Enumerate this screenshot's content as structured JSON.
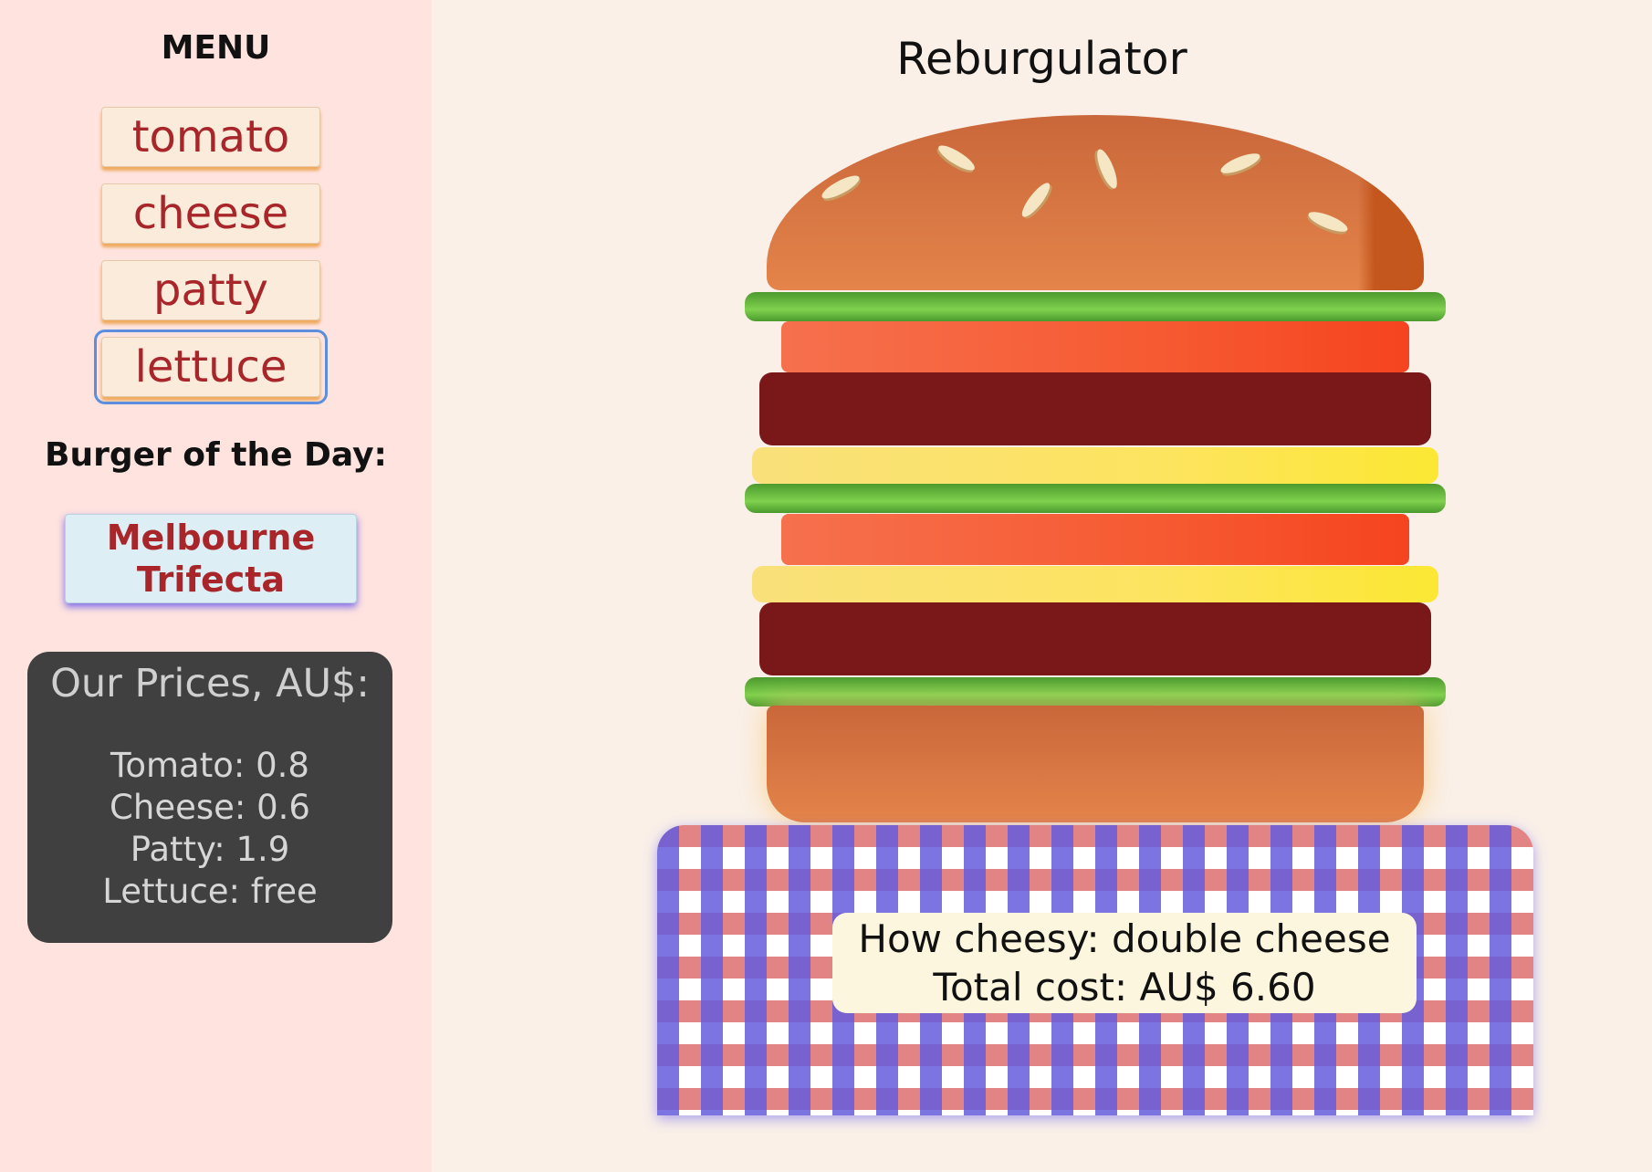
{
  "sidebar": {
    "menu_heading": "MENU",
    "menu_items": [
      {
        "label": "tomato"
      },
      {
        "label": "cheese"
      },
      {
        "label": "patty"
      },
      {
        "label": "lettuce"
      }
    ],
    "botd_heading": "Burger of the Day:",
    "botd_button": "Melbourne Trifecta",
    "prices": {
      "title": "Our Prices, AU$:",
      "lines": [
        "Tomato: 0.8",
        "Cheese: 0.6",
        "Patty: 1.9",
        "Lettuce: free"
      ]
    }
  },
  "main": {
    "title": "Reburgulator",
    "burger_layers": [
      "lettuce",
      "tomato",
      "patty",
      "cheese",
      "lettuce",
      "tomato",
      "cheese",
      "patty",
      "lettuce"
    ],
    "result": {
      "cheesiness": "How cheesy: double cheese",
      "total": "Total cost: AU$ 6.60"
    }
  },
  "colors": {
    "sidebar_bg": "#fee3df",
    "page_bg": "#faf0e8",
    "menu_text": "#a8252a",
    "prices_bg": "#414040",
    "lettuce": "#5cb43a",
    "tomato": "#f65a32",
    "patty": "#7a1819",
    "cheese": "#fde45f",
    "bun": "#e4844a"
  }
}
